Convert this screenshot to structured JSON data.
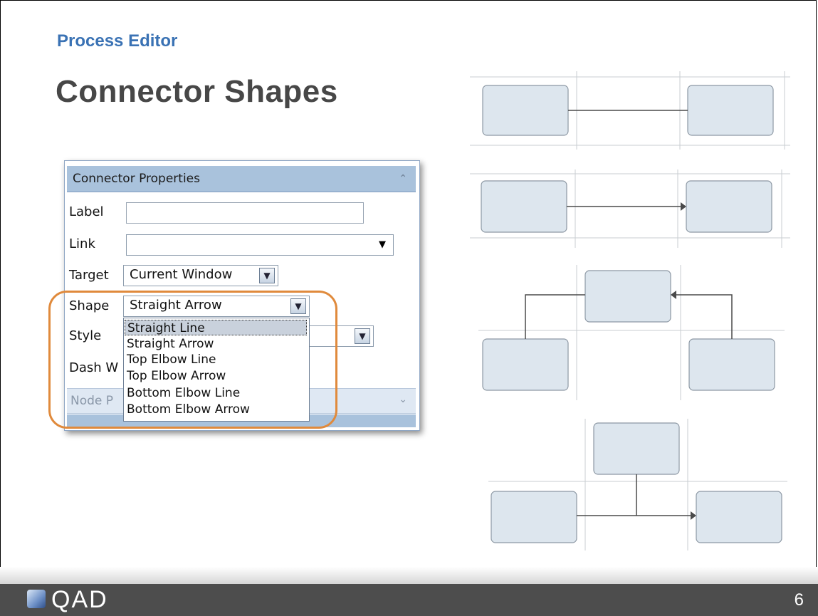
{
  "slide": {
    "eyebrow": "Process Editor",
    "title": "Connector Shapes",
    "page_number": "6"
  },
  "panel": {
    "title": "Connector Properties",
    "label_label": "Label",
    "label_value": "",
    "link_label": "Link",
    "link_value": "",
    "target_label": "Target",
    "target_value": "Current Window",
    "shape_label": "Shape",
    "shape_value": "Straight Arrow",
    "style_label": "Style",
    "dash_label": "Dash W",
    "node_section": "Node P",
    "shape_options": [
      "Straight Line",
      "Straight Arrow",
      "Top Elbow Line",
      "Top Elbow Arrow",
      "Bottom Elbow Line",
      "Bottom Elbow Arrow"
    ],
    "highlighted_option": "Straight Line"
  },
  "footer": {
    "logo_text": "QAD"
  },
  "colors": {
    "eyebrow": "#3a72b4",
    "title": "#474747",
    "panel_header": "#a9c2dc",
    "highlight_ring": "#e08a3c",
    "footer": "#4d4d4d"
  },
  "icons": [
    "chevron-up-icon",
    "chevron-down-icon",
    "dropdown-arrow-icon",
    "qad-logo-icon"
  ]
}
